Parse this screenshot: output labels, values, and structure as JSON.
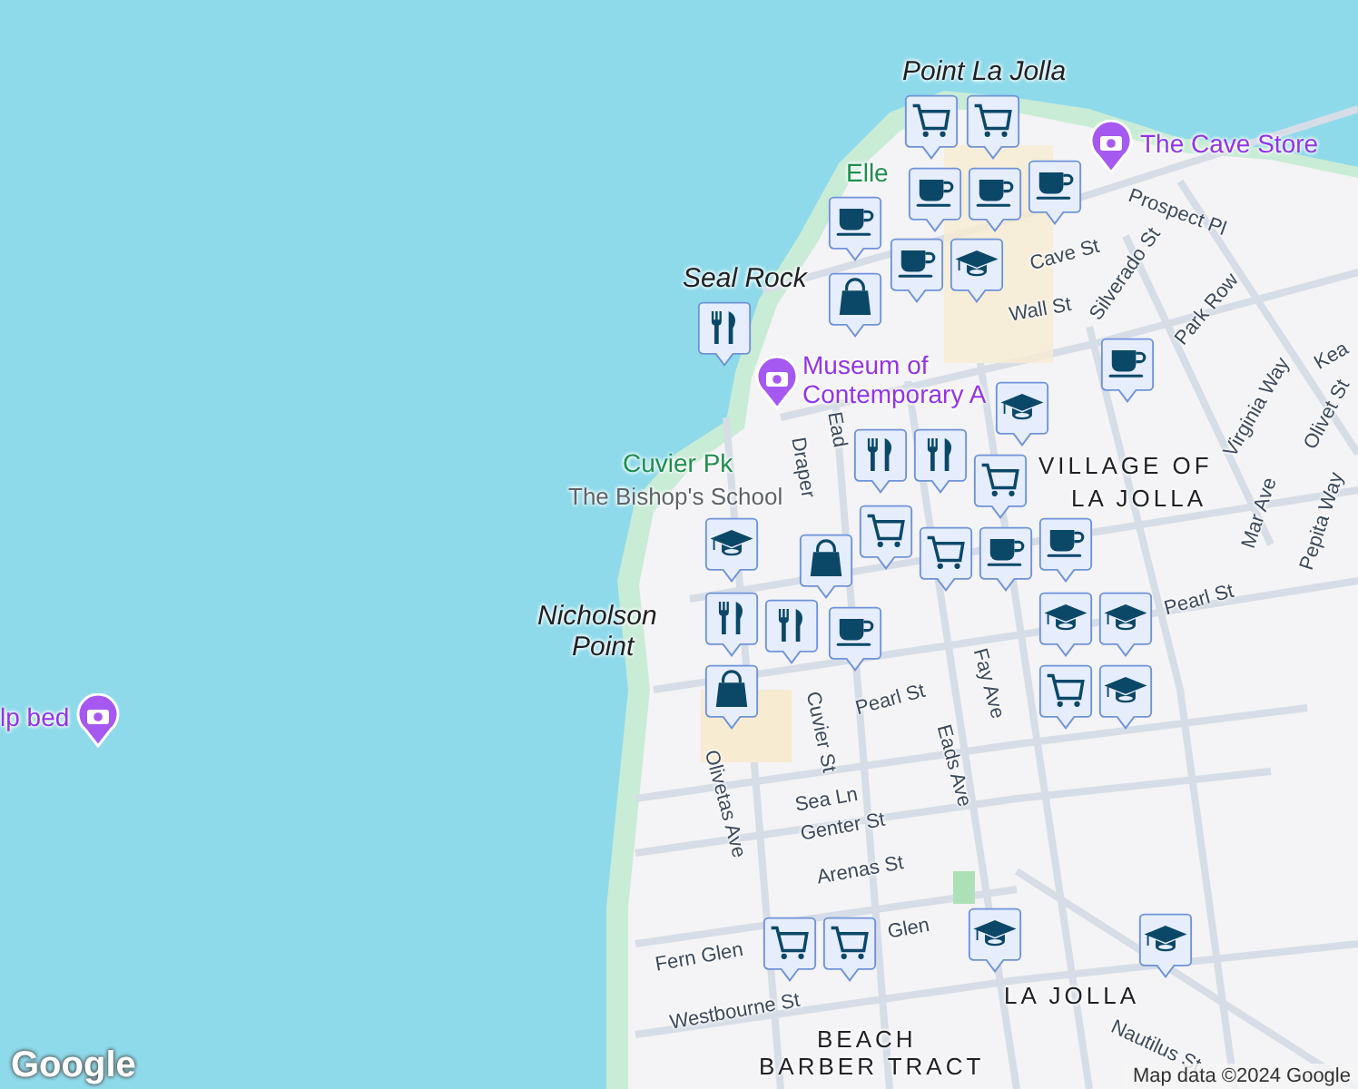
{
  "map": {
    "labels": [
      {
        "text": "Point La Jolla",
        "kind": "place"
      },
      {
        "text": "Elle",
        "kind": "park"
      },
      {
        "text": "The Cave Store",
        "kind": "poi"
      },
      {
        "text": "Seal Rock",
        "kind": "place"
      },
      {
        "text": "Cave St",
        "kind": "street"
      },
      {
        "text": "Prospect Pl",
        "kind": "street"
      },
      {
        "text": "Wall St",
        "kind": "street"
      },
      {
        "text": "Silverado St",
        "kind": "street"
      },
      {
        "text": "Park Row",
        "kind": "street"
      },
      {
        "text": "Museum of",
        "kind": "poi"
      },
      {
        "text": "Contemporary A",
        "kind": "poi"
      },
      {
        "text": "Virginia Way",
        "kind": "street"
      },
      {
        "text": "Olivet St",
        "kind": "street"
      },
      {
        "text": "Mar Ave",
        "kind": "street"
      },
      {
        "text": "Pepita Way",
        "kind": "street"
      },
      {
        "text": "Kea",
        "kind": "street"
      },
      {
        "text": "Cuvier Pk",
        "kind": "park"
      },
      {
        "text": "The Bishop's School",
        "kind": "school"
      },
      {
        "text": "Draper",
        "kind": "street"
      },
      {
        "text": "Ead",
        "kind": "street"
      },
      {
        "text": "VILLAGE OF",
        "kind": "area"
      },
      {
        "text": "LA JOLLA",
        "kind": "area"
      },
      {
        "text": "Nicholson",
        "kind": "place"
      },
      {
        "text": "Point",
        "kind": "place"
      },
      {
        "text": "Pearl St",
        "kind": "street"
      },
      {
        "text": "Pearl St",
        "kind": "street"
      },
      {
        "text": "Cuvier St",
        "kind": "street"
      },
      {
        "text": "Eads Ave",
        "kind": "street"
      },
      {
        "text": "Fay Ave",
        "kind": "street"
      },
      {
        "text": "Olivetas Ave",
        "kind": "street"
      },
      {
        "text": "Sea Ln",
        "kind": "street"
      },
      {
        "text": "Genter St",
        "kind": "street"
      },
      {
        "text": "Arenas St",
        "kind": "street"
      },
      {
        "text": "Glen",
        "kind": "street"
      },
      {
        "text": "Fern Glen",
        "kind": "street"
      },
      {
        "text": "Westbourne St",
        "kind": "street"
      },
      {
        "text": "LA JOLLA",
        "kind": "area"
      },
      {
        "text": "Nautilus St",
        "kind": "street"
      },
      {
        "text": "BEACH",
        "kind": "area"
      },
      {
        "text": "BARBER TRACT",
        "kind": "area"
      },
      {
        "text": "lp bed",
        "kind": "poi"
      }
    ],
    "markers": [
      {
        "kind": "cart"
      },
      {
        "kind": "cart"
      },
      {
        "kind": "cup"
      },
      {
        "kind": "cup"
      },
      {
        "kind": "cup"
      },
      {
        "kind": "cup"
      },
      {
        "kind": "cup"
      },
      {
        "kind": "cap"
      },
      {
        "kind": "bag"
      },
      {
        "kind": "fork"
      },
      {
        "kind": "cup"
      },
      {
        "kind": "cap"
      },
      {
        "kind": "fork"
      },
      {
        "kind": "fork"
      },
      {
        "kind": "cart"
      },
      {
        "kind": "cup"
      },
      {
        "kind": "cap"
      },
      {
        "kind": "bag"
      },
      {
        "kind": "cart"
      },
      {
        "kind": "cart"
      },
      {
        "kind": "cup"
      },
      {
        "kind": "fork"
      },
      {
        "kind": "fork"
      },
      {
        "kind": "cup"
      },
      {
        "kind": "bag"
      },
      {
        "kind": "cap"
      },
      {
        "kind": "cap"
      },
      {
        "kind": "cap"
      },
      {
        "kind": "cart"
      },
      {
        "kind": "cart"
      },
      {
        "kind": "cart"
      },
      {
        "kind": "cap"
      },
      {
        "kind": "cap"
      }
    ],
    "logo": "Google",
    "attribution": "Map data ©2024 Google"
  }
}
